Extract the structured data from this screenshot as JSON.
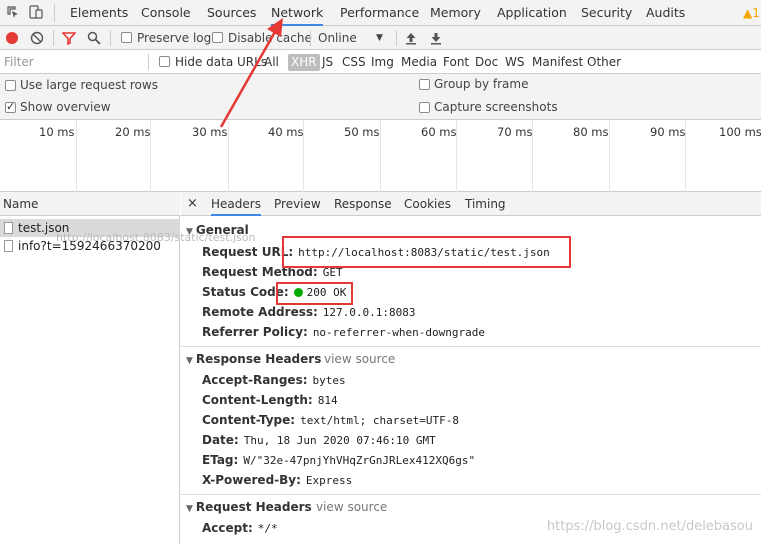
{
  "tabs": {
    "items": [
      "Elements",
      "Console",
      "Sources",
      "Network",
      "Performance",
      "Memory",
      "Application",
      "Security",
      "Audits"
    ],
    "warning_count": "1"
  },
  "toolbar": {
    "preserve_log": "Preserve log",
    "disable_cache": "Disable cache",
    "throttle_value": "Online"
  },
  "filter": {
    "placeholder": "Filter",
    "hide_data_urls": "Hide data URLs",
    "types": [
      "All",
      "XHR",
      "JS",
      "CSS",
      "Img",
      "Media",
      "Font",
      "Doc",
      "WS",
      "Manifest",
      "Other"
    ]
  },
  "options": {
    "large_rows": "Use large request rows",
    "show_overview": "Show overview",
    "group_by_frame": "Group by frame",
    "capture_screenshots": "Capture screenshots"
  },
  "overview": {
    "ticks": [
      "10 ms",
      "20 ms",
      "30 ms",
      "40 ms",
      "50 ms",
      "60 ms",
      "70 ms",
      "80 ms",
      "90 ms",
      "100 ms"
    ]
  },
  "requests": {
    "header": "Name",
    "items": [
      "test.json",
      "info?t=1592466370200"
    ],
    "tooltip": "http://localhost:8083/static/test.json"
  },
  "details": {
    "tabs": [
      "Headers",
      "Preview",
      "Response",
      "Cookies",
      "Timing"
    ],
    "general": {
      "title": "General",
      "rows": [
        {
          "k": "Request URL:",
          "v": "http://localhost:8083/static/test.json"
        },
        {
          "k": "Request Method:",
          "v": "GET"
        },
        {
          "k": "Status Code:",
          "v": "200 OK"
        },
        {
          "k": "Remote Address:",
          "v": "127.0.0.1:8083"
        },
        {
          "k": "Referrer Policy:",
          "v": "no-referrer-when-downgrade"
        }
      ]
    },
    "response_headers": {
      "title": "Response Headers",
      "view_source": "view source",
      "rows": [
        {
          "k": "Accept-Ranges:",
          "v": "bytes"
        },
        {
          "k": "Content-Length:",
          "v": "814"
        },
        {
          "k": "Content-Type:",
          "v": "text/html; charset=UTF-8"
        },
        {
          "k": "Date:",
          "v": "Thu, 18 Jun 2020 07:46:10 GMT"
        },
        {
          "k": "ETag:",
          "v": "W/\"32e-47pnjYhVHqZrGnJRLex412XQ6gs\""
        },
        {
          "k": "X-Powered-By:",
          "v": "Express"
        }
      ]
    },
    "request_headers": {
      "title": "Request Headers",
      "view_source": "view source",
      "rows": [
        {
          "k": "Accept:",
          "v": "*/*"
        }
      ]
    }
  },
  "watermark": "https://blog.csdn.net/delebasou",
  "colors": {
    "accent": "#3f87e3",
    "annotation": "#e53935",
    "status_ok": "#00aa00"
  }
}
